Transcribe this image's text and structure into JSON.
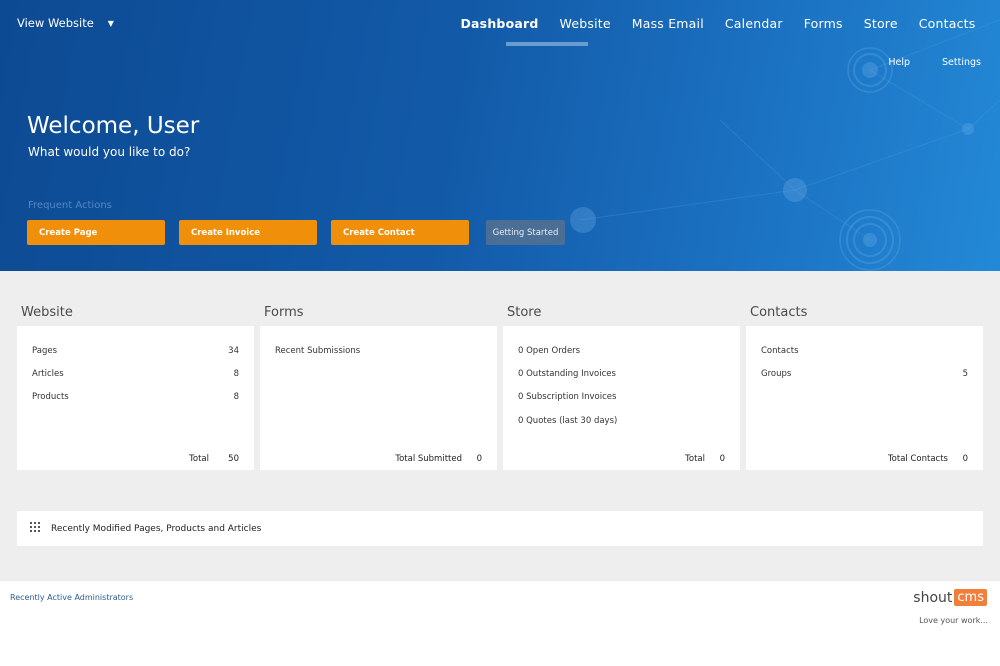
{
  "header": {
    "view_website": "View Website",
    "nav": [
      "Dashboard",
      "Website",
      "Mass Email",
      "Calendar",
      "Forms",
      "Store",
      "Contacts"
    ],
    "active_nav": "Dashboard",
    "help": "Help",
    "settings": "Settings"
  },
  "hero": {
    "welcome": "Welcome, User",
    "question": "What would you like to do?",
    "frequent_label": "Frequent Actions",
    "actions": [
      "Create Page",
      "Create Invoice",
      "Create Contact"
    ],
    "getting_started": "Getting Started"
  },
  "panels": {
    "website": {
      "title": "Website",
      "rows": [
        {
          "label": "Pages",
          "value": "34"
        },
        {
          "label": "Articles",
          "value": "8"
        },
        {
          "label": "Products",
          "value": "8"
        }
      ],
      "total_label": "Total",
      "total_value": "50"
    },
    "forms": {
      "title": "Forms",
      "rows": [
        {
          "label": "Recent Submissions",
          "value": ""
        }
      ],
      "total_label": "Total Submitted",
      "total_value": "0"
    },
    "store": {
      "title": "Store",
      "rows": [
        {
          "label": "0 Open Orders",
          "value": ""
        },
        {
          "label": "0 Outstanding Invoices",
          "value": ""
        },
        {
          "label": "0 Subscription Invoices",
          "value": ""
        },
        {
          "label": "0 Quotes (last 30 days)",
          "value": ""
        }
      ],
      "total_label": "Total",
      "total_value": "0"
    },
    "contacts": {
      "title": "Contacts",
      "rows": [
        {
          "label": "Contacts",
          "value": ""
        },
        {
          "label": "Groups",
          "value": "5"
        }
      ],
      "total_label": "Total Contacts",
      "total_value": "0"
    }
  },
  "recent_modified": "Recently Modified Pages, Products and Articles",
  "footer": {
    "admins": "Recently Active Administrators",
    "logo_shout": "shout",
    "logo_cms": "cms",
    "tagline": "Love your work..."
  },
  "colors": {
    "hero_dark": "#0d4a93",
    "hero_light": "#2389d6",
    "action_orange": "#ef8f0a",
    "getting_started": "#4a6e94",
    "logo_orange": "#f07f3c"
  }
}
